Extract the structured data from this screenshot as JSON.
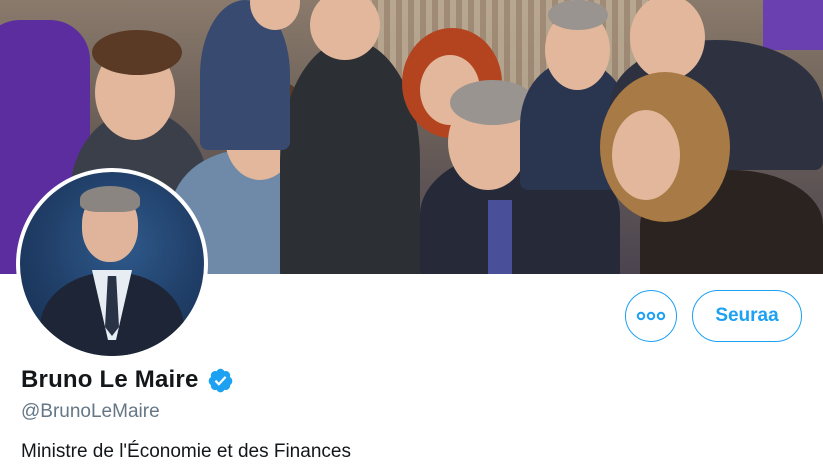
{
  "profile": {
    "display_name": "Bruno Le Maire",
    "handle": "@BrunoLeMaire",
    "bio": "Ministre de l'Économie et des Finances",
    "verified": true
  },
  "actions": {
    "more_icon": "more-options-icon",
    "follow_label": "Seuraa"
  },
  "colors": {
    "accent": "#1da1f2",
    "name_text": "#14171a",
    "handle_text": "#657786"
  },
  "icons": {
    "verified": "verified-badge-icon",
    "more": "ellipsis-icon"
  }
}
